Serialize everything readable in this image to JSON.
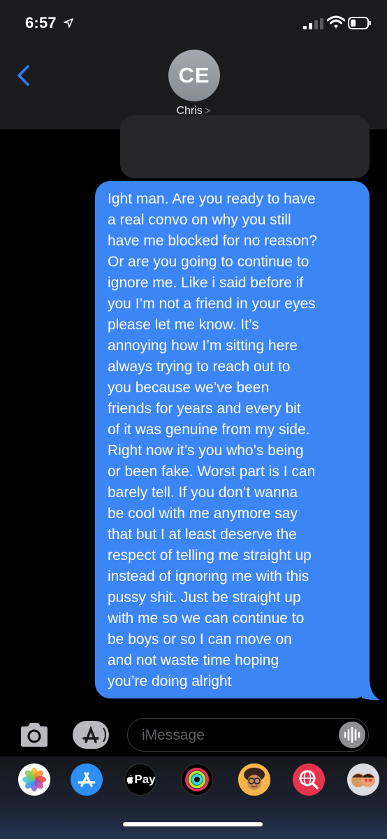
{
  "status_bar": {
    "time": "6:57"
  },
  "contact": {
    "initials": "CE",
    "name": "Chris",
    "chevron": ">"
  },
  "messages": [
    {
      "direction": "sent",
      "text": "Ight man. Are you ready to have\na real convo on why you still\nhave me blocked for no reason?\nOr are you going to continue to\nignore me. Like i said before if\nyou I’m not a friend in your eyes\nplease let me know. It’s\nannoying how I’m sitting here\nalways trying to reach out to\nyou because we’ve been\nfriends for years and every bit\nof it was genuine from my side.\nRight now it’s you who’s being\nor been fake. Worst part is I can\nbarely tell. If you don’t wanna\nbe cool with me anymore say\nthat but I at least deserve the\nrespect of telling me straight up\ninstead of ignoring me with this\npussy shit. Just be straight up\nwith me so we can continue to\nbe boys or so I can move on\nand not waste time hoping\nyou’re doing alright"
    }
  ],
  "composer": {
    "placeholder": "iMessage"
  },
  "app_drawer": {
    "items": [
      {
        "icon": "photos-icon"
      },
      {
        "icon": "app-store-icon"
      },
      {
        "icon": "apple-pay-icon",
        "label": "Pay"
      },
      {
        "icon": "activity-icon"
      },
      {
        "icon": "memoji-icon"
      },
      {
        "icon": "web-search-icon"
      },
      {
        "icon": "memoji-stickers-icon"
      }
    ]
  },
  "colors": {
    "sent_bubble": "#3c85f5",
    "accent_blue": "#2f7cf6",
    "header_bg": "#1b1b1d"
  }
}
